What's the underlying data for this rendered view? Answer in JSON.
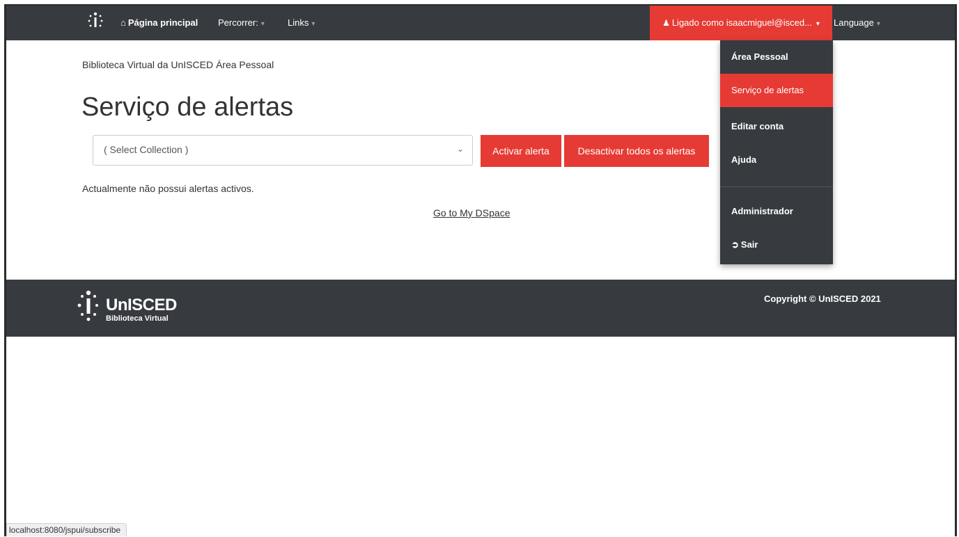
{
  "nav": {
    "home_label": "Página principal",
    "browse_label": "Percorrer:",
    "links_label": "Links",
    "user_label": "Ligado como isaacmiguel@isced...",
    "language_label": "Language"
  },
  "dropdown": {
    "items": [
      "Área Pessoal",
      "Serviço de alertas",
      "Editar conta",
      "Ajuda",
      "Administrador",
      "Sair"
    ],
    "active_item": "Serviço de alertas"
  },
  "main": {
    "breadcrumb": "Biblioteca Virtual da UnISCED Área Pessoal",
    "title": "Serviço de alertas",
    "collection_select": "( Select Collection )",
    "activate_button": "Activar alerta",
    "deactivate_all_button": "Desactivar todos os alertas",
    "no_alerts_message": "Actualmente não possui alertas activos.",
    "my_dspace_link": "Go to My DSpace"
  },
  "footer": {
    "brand": "UnISCED",
    "subtitle": "Biblioteca Virtual",
    "copyright": "Copyright © UnISCED 2021"
  },
  "status_bar": {
    "url": "localhost:8080/jspui/subscribe"
  },
  "colors": {
    "navbar": "#373b40",
    "accent": "#e53b34",
    "text": "#333333"
  },
  "icons": [
    "home-icon",
    "user-icon",
    "caret-down-icon",
    "chevron-down-icon",
    "sign-out-icon",
    "unisced-logo"
  ]
}
